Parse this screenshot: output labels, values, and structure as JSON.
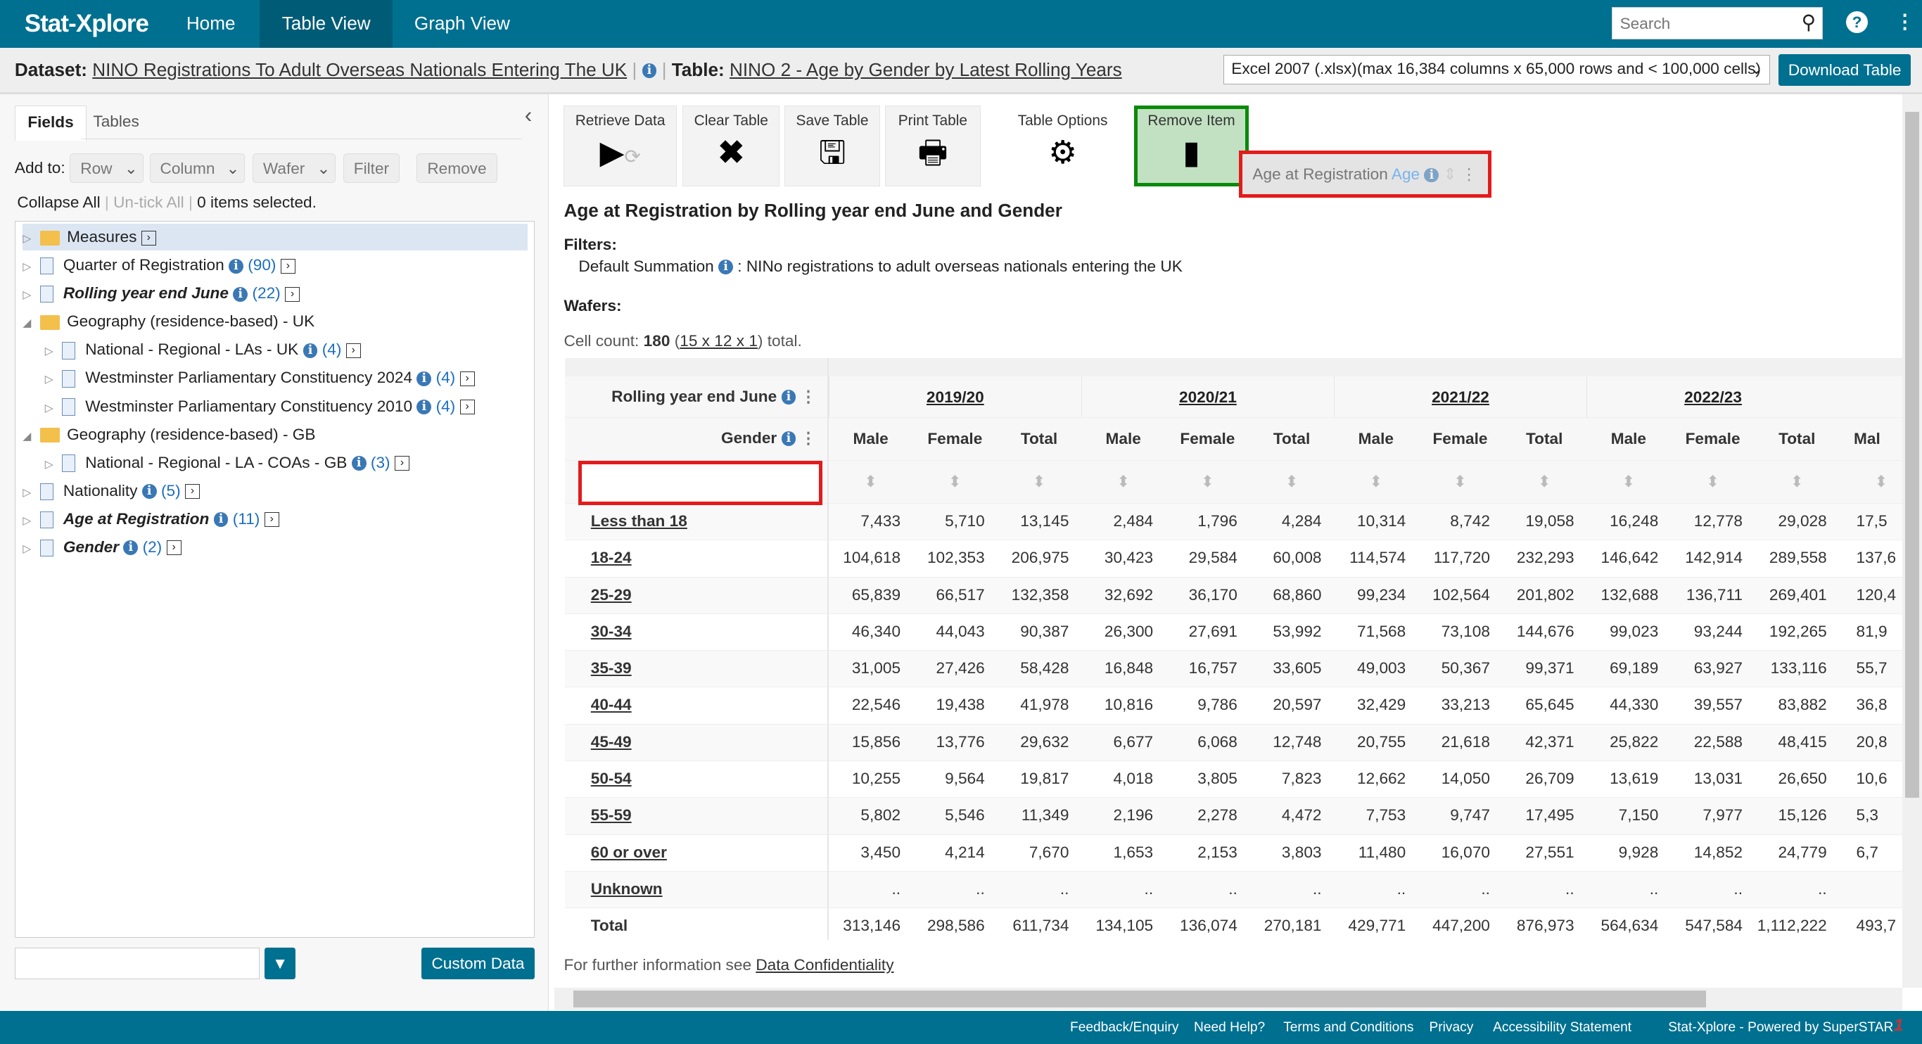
{
  "app": {
    "logo": "Stat-Xplore",
    "nav": [
      "Home",
      "Table View",
      "Graph View"
    ],
    "active_nav": "Table View",
    "search_placeholder": "Search"
  },
  "dataset": {
    "label": "Dataset:",
    "name": "NINO Registrations To Adult Overseas Nationals Entering The UK",
    "table_label": "Table:",
    "table_name": "NINO 2 - Age by Gender by Latest Rolling Years",
    "format": "Excel 2007 (.xlsx)(max 16,384 columns x 65,000 rows and < 100,000 cells)",
    "download": "Download Table"
  },
  "left": {
    "tabs": [
      "Fields",
      "Tables"
    ],
    "add_to": "Add to:",
    "buttons": [
      "Row",
      "Column",
      "Wafer",
      "Filter",
      "Remove"
    ],
    "collapse": "Collapse All",
    "untick": "Un-tick All",
    "selected": "0 items selected.",
    "custom_data": "Custom Data",
    "tree": [
      {
        "label": "Measures",
        "level": 0,
        "type": "measure",
        "arrow": "▷",
        "count": "",
        "info": false,
        "style": "",
        "selected": true
      },
      {
        "label": "Quarter of Registration",
        "level": 0,
        "type": "doc",
        "arrow": "▷",
        "count": "(90)",
        "info": true,
        "style": ""
      },
      {
        "label": "Rolling year end June",
        "level": 0,
        "type": "doc",
        "arrow": "▷",
        "count": "(22)",
        "info": true,
        "style": "bi"
      },
      {
        "label": "Geography (residence-based) - UK",
        "level": 0,
        "type": "folder",
        "arrow": "◢",
        "count": "",
        "info": false,
        "style": "",
        "nogo": true
      },
      {
        "label": "National - Regional - LAs - UK",
        "level": 1,
        "type": "doc",
        "arrow": "▷",
        "count": "(4)",
        "info": true,
        "style": ""
      },
      {
        "label": "Westminster Parliamentary Constituency 2024",
        "level": 1,
        "type": "doc",
        "arrow": "▷",
        "count": "(4)",
        "info": true,
        "style": ""
      },
      {
        "label": "Westminster Parliamentary Constituency 2010",
        "level": 1,
        "type": "doc",
        "arrow": "▷",
        "count": "(4)",
        "info": true,
        "style": ""
      },
      {
        "label": "Geography (residence-based) - GB",
        "level": 0,
        "type": "folder",
        "arrow": "◢",
        "count": "",
        "info": false,
        "style": "",
        "nogo": true
      },
      {
        "label": "National - Regional - LA - COAs - GB",
        "level": 1,
        "type": "doc",
        "arrow": "▷",
        "count": "(3)",
        "info": true,
        "style": ""
      },
      {
        "label": "Nationality",
        "level": 0,
        "type": "doc",
        "arrow": "▷",
        "count": "(5)",
        "info": true,
        "style": ""
      },
      {
        "label": "Age at Registration",
        "level": 0,
        "type": "doc",
        "arrow": "▷",
        "count": "(11)",
        "info": true,
        "style": "bi"
      },
      {
        "label": "Gender",
        "level": 0,
        "type": "doc",
        "arrow": "▷",
        "count": "(2)",
        "info": true,
        "style": "bi"
      }
    ]
  },
  "toolbar": [
    "Retrieve Data",
    "Clear Table",
    "Save Table",
    "Print Table",
    "Table Options",
    "Remove Item"
  ],
  "drag_item": {
    "label": "Age at Registration",
    "sub": "Age"
  },
  "main": {
    "title": "Age at Registration by Rolling year end June and Gender",
    "filters_label": "Filters:",
    "filter_name": "Default Summation",
    "filter_value": ": NINo registrations to adult overseas nationals entering the UK",
    "wafers_label": "Wafers:",
    "cell_count_prefix": "Cell count:",
    "cell_count": "180",
    "cell_dims": "15 x 12 x 1",
    "cell_count_suffix": "total.",
    "footnote": "For further information see",
    "footnote_link": "Data Confidentiality"
  },
  "table": {
    "row_dim": "Rolling year end June",
    "col_dim": "Gender",
    "years": [
      "2019/20",
      "2020/21",
      "2021/22",
      "2022/23"
    ],
    "genders": [
      "Male",
      "Female",
      "Total",
      "Male",
      "Female",
      "Total",
      "Male",
      "Female",
      "Total",
      "Male",
      "Female",
      "Total",
      "Mal"
    ],
    "rows": [
      {
        "label": "Less than 18",
        "values": [
          "7,433",
          "5,710",
          "13,145",
          "2,484",
          "1,796",
          "4,284",
          "10,314",
          "8,742",
          "19,058",
          "16,248",
          "12,778",
          "29,028",
          "17,5"
        ]
      },
      {
        "label": "18-24",
        "values": [
          "104,618",
          "102,353",
          "206,975",
          "30,423",
          "29,584",
          "60,008",
          "114,574",
          "117,720",
          "232,293",
          "146,642",
          "142,914",
          "289,558",
          "137,6"
        ]
      },
      {
        "label": "25-29",
        "values": [
          "65,839",
          "66,517",
          "132,358",
          "32,692",
          "36,170",
          "68,860",
          "99,234",
          "102,564",
          "201,802",
          "132,688",
          "136,711",
          "269,401",
          "120,4"
        ]
      },
      {
        "label": "30-34",
        "values": [
          "46,340",
          "44,043",
          "90,387",
          "26,300",
          "27,691",
          "53,992",
          "71,568",
          "73,108",
          "144,676",
          "99,023",
          "93,244",
          "192,265",
          "81,9"
        ]
      },
      {
        "label": "35-39",
        "values": [
          "31,005",
          "27,426",
          "58,428",
          "16,848",
          "16,757",
          "33,605",
          "49,003",
          "50,367",
          "99,371",
          "69,189",
          "63,927",
          "133,116",
          "55,7"
        ]
      },
      {
        "label": "40-44",
        "values": [
          "22,546",
          "19,438",
          "41,978",
          "10,816",
          "9,786",
          "20,597",
          "32,429",
          "33,213",
          "65,645",
          "44,330",
          "39,557",
          "83,882",
          "36,8"
        ]
      },
      {
        "label": "45-49",
        "values": [
          "15,856",
          "13,776",
          "29,632",
          "6,677",
          "6,068",
          "12,748",
          "20,755",
          "21,618",
          "42,371",
          "25,822",
          "22,588",
          "48,415",
          "20,8"
        ]
      },
      {
        "label": "50-54",
        "values": [
          "10,255",
          "9,564",
          "19,817",
          "4,018",
          "3,805",
          "7,823",
          "12,662",
          "14,050",
          "26,709",
          "13,619",
          "13,031",
          "26,650",
          "10,6"
        ]
      },
      {
        "label": "55-59",
        "values": [
          "5,802",
          "5,546",
          "11,349",
          "2,196",
          "2,278",
          "4,472",
          "7,753",
          "9,747",
          "17,495",
          "7,150",
          "7,977",
          "15,126",
          "5,3"
        ]
      },
      {
        "label": "60 or over",
        "values": [
          "3,450",
          "4,214",
          "7,670",
          "1,653",
          "2,153",
          "3,803",
          "11,480",
          "16,070",
          "27,551",
          "9,928",
          "14,852",
          "24,779",
          "6,7"
        ]
      },
      {
        "label": "Unknown",
        "values": [
          "..",
          "..",
          "..",
          "..",
          "..",
          "..",
          "..",
          "..",
          "..",
          "..",
          "..",
          "..",
          ""
        ]
      },
      {
        "label": "Total",
        "values": [
          "313,146",
          "298,586",
          "611,734",
          "134,105",
          "136,074",
          "270,181",
          "429,771",
          "447,200",
          "876,973",
          "564,634",
          "547,584",
          "1,112,222",
          "493,7"
        ],
        "total": true
      }
    ]
  },
  "footer": {
    "links": [
      "Feedback/Enquiry",
      "Need Help?",
      "Terms and Conditions",
      "Privacy",
      "Accessibility Statement"
    ],
    "powered": "Stat-Xplore - Powered by SuperSTAR"
  },
  "colors": {
    "brand": "#007090",
    "highlight_red": "#e31b1b",
    "remove_green": "#0a8a0a"
  }
}
